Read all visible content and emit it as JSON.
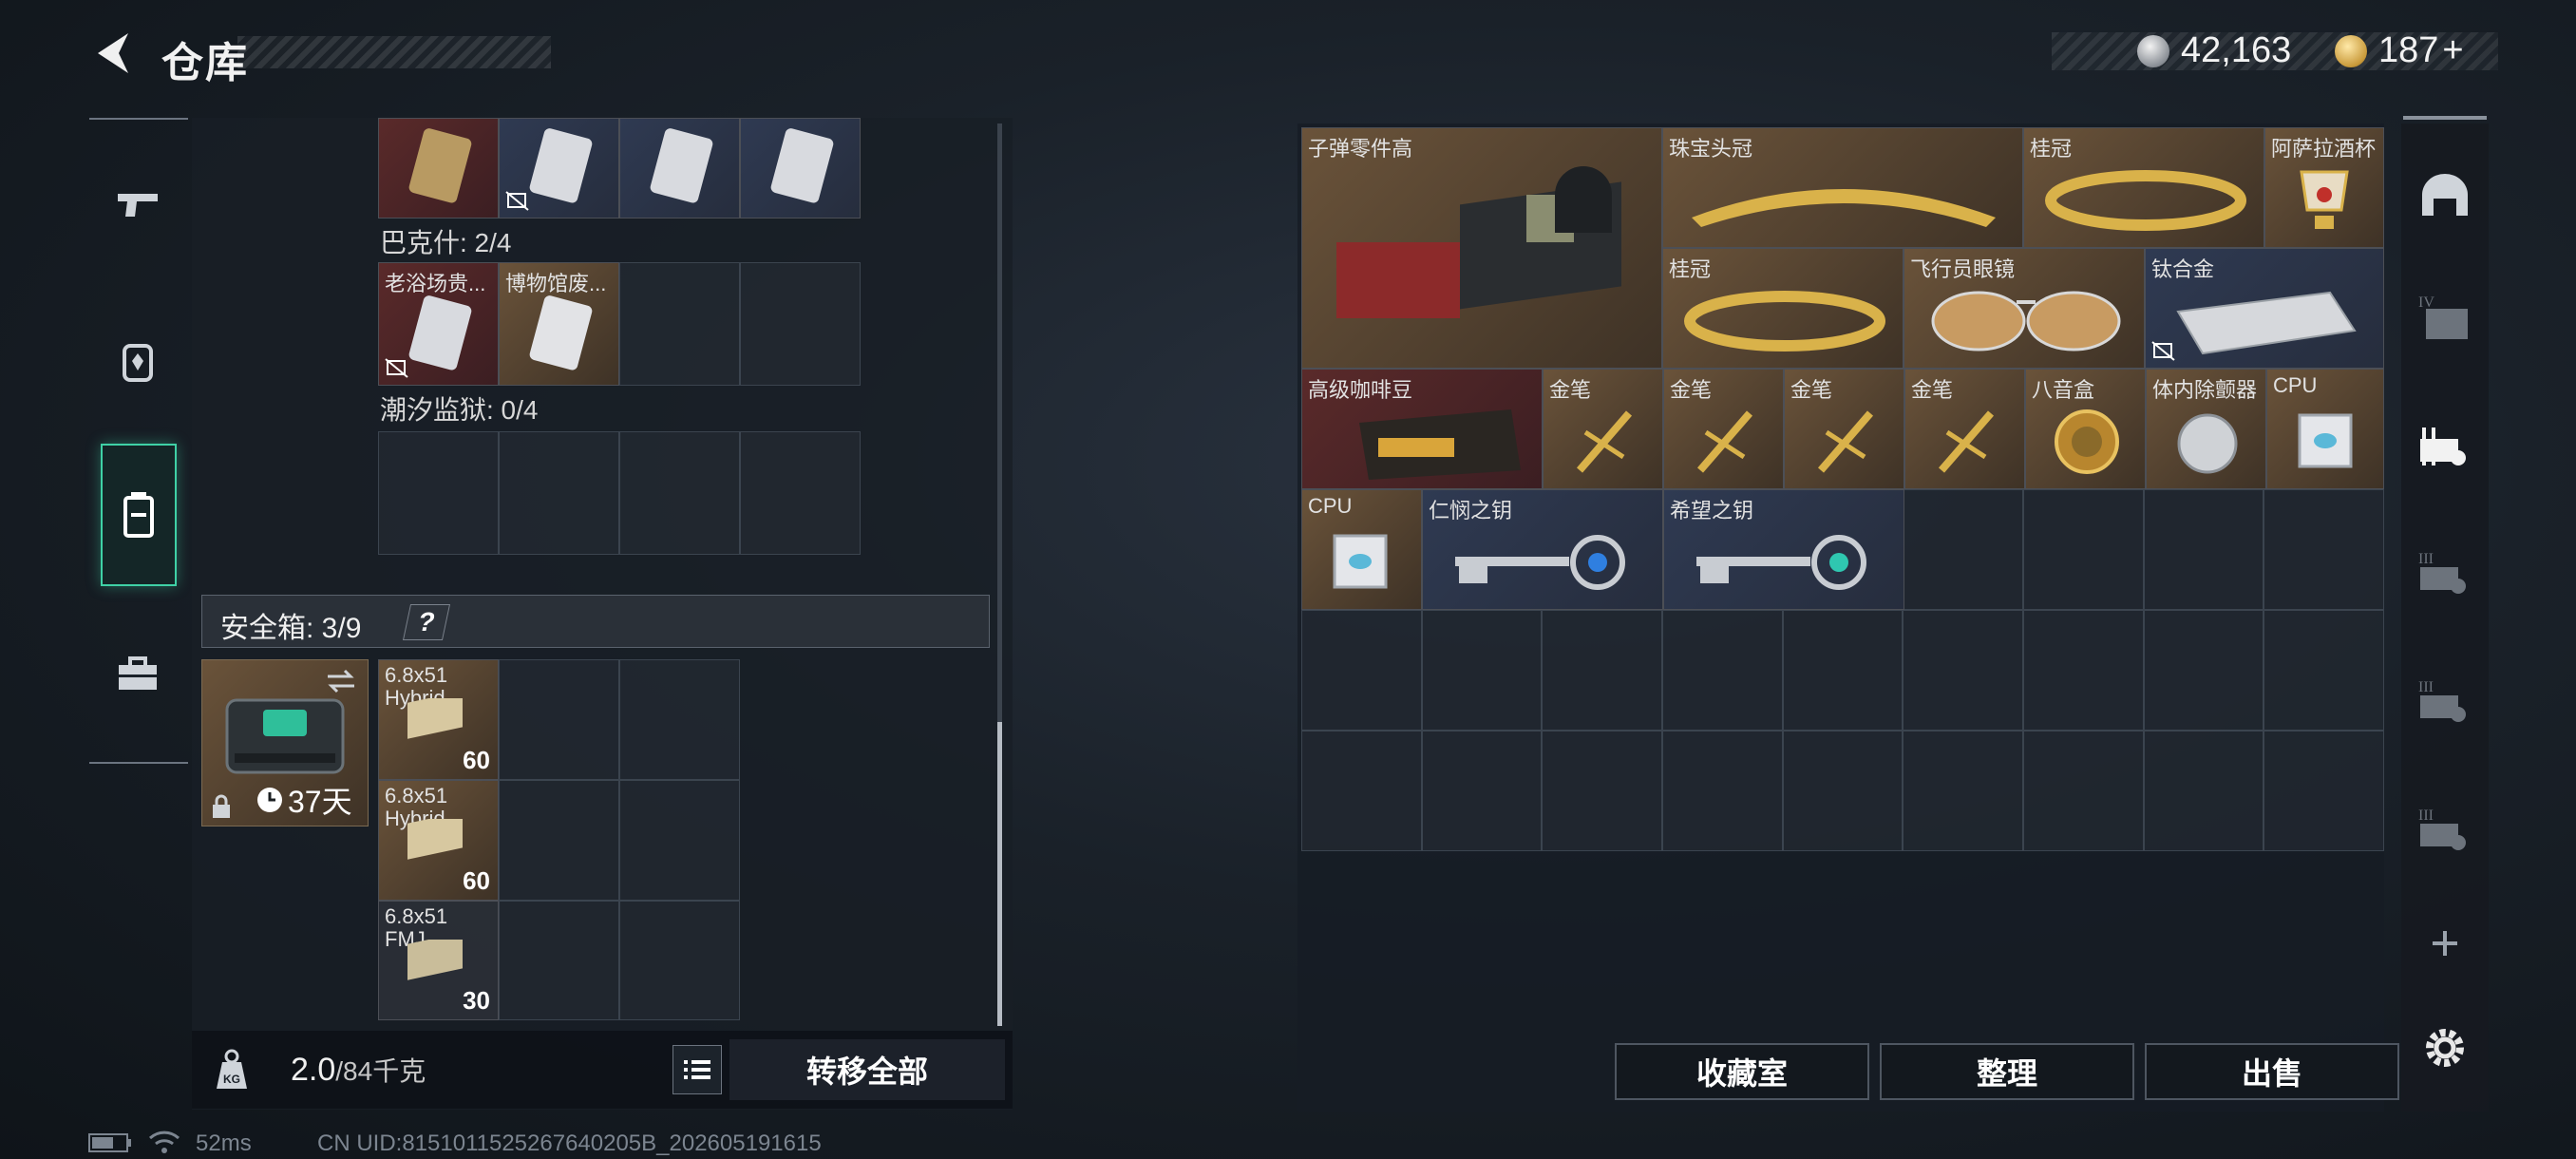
{
  "header": {
    "title": "仓库",
    "currency_primary": "42,163",
    "currency_premium": "187",
    "currency_add": "+"
  },
  "left_nav": [
    {
      "icon": "gun-icon"
    },
    {
      "icon": "backpack-icon"
    },
    {
      "icon": "vest-icon",
      "active": true
    },
    {
      "icon": "toolbox-icon"
    }
  ],
  "collections": [
    {
      "label": "",
      "cells": [
        {
          "name": "",
          "tone": "red"
        },
        {
          "name": "",
          "tone": "blue",
          "tag": true
        },
        {
          "name": "",
          "tone": "blue"
        },
        {
          "name": "",
          "tone": "blue"
        }
      ]
    },
    {
      "label": "巴克什: 2/4",
      "cells": [
        {
          "name": "老浴场贵...",
          "tone": "red",
          "tag": true
        },
        {
          "name": "博物馆废...",
          "tone": "gold"
        },
        {
          "name": "",
          "tone": "empty"
        },
        {
          "name": "",
          "tone": "empty"
        }
      ]
    },
    {
      "label": "潮汐监狱: 0/4",
      "cells": [
        {
          "name": "",
          "tone": "empty"
        },
        {
          "name": "",
          "tone": "empty"
        },
        {
          "name": "",
          "tone": "empty"
        },
        {
          "name": "",
          "tone": "empty"
        }
      ]
    }
  ],
  "safe_box": {
    "label": "安全箱: 3/9",
    "help": "?",
    "duration": "37天",
    "items": [
      {
        "name": "6.8x51 Hybrid",
        "count": "60"
      },
      {
        "name": "6.8x51 Hybrid",
        "count": "60"
      },
      {
        "name": "6.8x51 FMJ",
        "count": "30"
      }
    ]
  },
  "weight": {
    "current": "2.0",
    "max": "/84千克"
  },
  "transfer_all": "转移全部",
  "stash_items": [
    {
      "name": "子弹零件高",
      "tone": "gold"
    },
    {
      "name": "珠宝头冠",
      "tone": "gold"
    },
    {
      "name": "桂冠",
      "tone": "gold"
    },
    {
      "name": "阿萨拉酒杯",
      "tone": "gold"
    },
    {
      "name": "桂冠",
      "tone": "gold"
    },
    {
      "name": "飞行员眼镜",
      "tone": "gold"
    },
    {
      "name": "钛合金",
      "tone": "blue"
    },
    {
      "name": "高级咖啡豆",
      "tone": "red"
    },
    {
      "name": "金笔",
      "tone": "gold"
    },
    {
      "name": "金笔",
      "tone": "gold"
    },
    {
      "name": "金笔",
      "tone": "gold"
    },
    {
      "name": "金笔",
      "tone": "gold"
    },
    {
      "name": "八音盒",
      "tone": "gold"
    },
    {
      "name": "体内除颤器",
      "tone": "gold"
    },
    {
      "name": "CPU",
      "tone": "gold"
    },
    {
      "name": "CPU",
      "tone": "gold"
    },
    {
      "name": "仁悯之钥",
      "tone": "blue"
    },
    {
      "name": "希望之钥",
      "tone": "blue"
    }
  ],
  "buttons": {
    "collection_room": "收藏室",
    "organize": "整理",
    "sell": "出售"
  },
  "right_tabs": [
    {
      "icon": "helmet-icon",
      "roman": ""
    },
    {
      "icon": "folder-icon",
      "roman": "IV"
    },
    {
      "icon": "rack-icon",
      "roman": ""
    },
    {
      "icon": "rack-icon",
      "roman": "III"
    },
    {
      "icon": "rack-icon",
      "roman": "III"
    },
    {
      "icon": "rack-icon",
      "roman": "III"
    }
  ],
  "status": {
    "ping": "52ms",
    "uid": "CN UID:8151011525267640205B_202605191615"
  },
  "colors": {
    "accent": "#3fd1a6",
    "gold_tone": "#6a533a",
    "red_tone": "#5a2a2a",
    "blue_tone": "#2f3a52"
  }
}
